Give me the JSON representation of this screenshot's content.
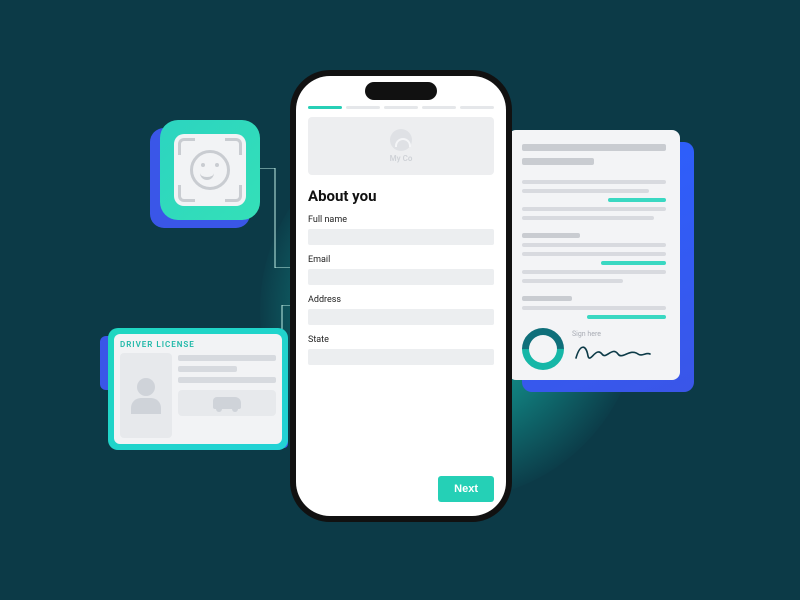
{
  "phone": {
    "brand": "My Co",
    "form_title": "About you",
    "fields": {
      "full_name": "Full name",
      "email": "Email",
      "address": "Address",
      "state": "State"
    },
    "next_button": "Next"
  },
  "driver_license": {
    "title": "DRIVER LICENSE"
  },
  "document": {
    "sign_label": "Sign here"
  }
}
